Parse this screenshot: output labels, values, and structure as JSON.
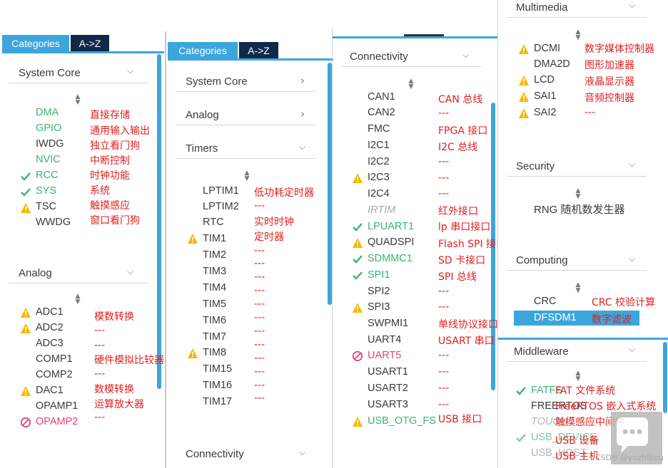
{
  "colors": {
    "accent": "#3ca6dc",
    "tab_dark": "#10284a",
    "ok": "#3cb46e",
    "warn": "#f5b800",
    "err": "#e0457b",
    "annotation": "#e02020"
  },
  "panel1": {
    "tabs": [
      "Categories",
      "A->Z"
    ],
    "sections": [
      "System Core",
      "Analog"
    ],
    "system_core": [
      {
        "name": "DMA",
        "anno": "直接存储"
      },
      {
        "name": "GPIO",
        "anno": "通用输入输出"
      },
      {
        "name": "IWDG",
        "anno": "独立看门狗"
      },
      {
        "name": "NVIC",
        "anno": "中断控制"
      },
      {
        "name": "RCC",
        "anno": "时钟功能"
      },
      {
        "name": "SYS",
        "anno": "系统"
      },
      {
        "name": "TSC",
        "anno": "触摸感应"
      },
      {
        "name": "WWDG",
        "anno": "窗口看门狗"
      }
    ],
    "analog": [
      {
        "name": "ADC1",
        "anno": "模数转换"
      },
      {
        "name": "ADC2",
        "anno": "---"
      },
      {
        "name": "ADC3",
        "anno": "---"
      },
      {
        "name": "COMP1",
        "anno": "硬件模拟比较器"
      },
      {
        "name": "COMP2",
        "anno": "---"
      },
      {
        "name": "DAC1",
        "anno": "数模转换"
      },
      {
        "name": "OPAMP1",
        "anno": "运算放大器"
      },
      {
        "name": "OPAMP2",
        "anno": "---"
      }
    ]
  },
  "panel2": {
    "tabs": [
      "Categories",
      "A->Z"
    ],
    "sections": [
      "System Core",
      "Analog",
      "Timers",
      "Connectivity"
    ],
    "timers": [
      {
        "name": "LPTIM1",
        "anno": "低功耗定时器"
      },
      {
        "name": "LPTIM2",
        "anno": "---"
      },
      {
        "name": "RTC",
        "anno": "实时时钟"
      },
      {
        "name": "TIM1",
        "anno": "定时器"
      },
      {
        "name": "TIM2",
        "anno": "---"
      },
      {
        "name": "TIM3",
        "anno": "---"
      },
      {
        "name": "TIM4",
        "anno": "---"
      },
      {
        "name": "TIM5",
        "anno": "---"
      },
      {
        "name": "TIM6",
        "anno": "---"
      },
      {
        "name": "TIM7",
        "anno": "---"
      },
      {
        "name": "TIM8",
        "anno": "---"
      },
      {
        "name": "TIM15",
        "anno": "---"
      },
      {
        "name": "TIM16",
        "anno": "---"
      },
      {
        "name": "TIM17",
        "anno": "---"
      }
    ],
    "extra_dashes": [
      "---",
      "---",
      "---",
      "---",
      "---",
      "---",
      "---",
      "---",
      "---",
      "---",
      "---",
      "---",
      "---",
      "---",
      "---"
    ]
  },
  "panel3": {
    "section": "Connectivity",
    "items": [
      {
        "name": "CAN1",
        "anno": "CAN 总线"
      },
      {
        "name": "CAN2",
        "anno": "---"
      },
      {
        "name": "FMC",
        "anno": "FPGA 接口"
      },
      {
        "name": "I2C1",
        "anno": "I2C 总线"
      },
      {
        "name": "I2C2",
        "anno": "---"
      },
      {
        "name": "I2C3",
        "anno": "---"
      },
      {
        "name": "I2C4",
        "anno": "---"
      },
      {
        "name": "IRTIM",
        "anno": "红外接口"
      },
      {
        "name": "LPUART1",
        "anno": "lp 串口接口"
      },
      {
        "name": "QUADSPI",
        "anno": "Flash SPI 接口"
      },
      {
        "name": "SDMMC1",
        "anno": "SD 卡接口"
      },
      {
        "name": "SPI1",
        "anno": "SPI 总线"
      },
      {
        "name": "SPI2",
        "anno": "---"
      },
      {
        "name": "SPI3",
        "anno": "---"
      },
      {
        "name": "SWPMI1",
        "anno": "单线协议接口"
      },
      {
        "name": "UART4",
        "anno": "USART 串口"
      },
      {
        "name": "UART5",
        "anno": "---"
      },
      {
        "name": "USART1",
        "anno": "---"
      },
      {
        "name": "USART2",
        "anno": "---"
      },
      {
        "name": "USART3",
        "anno": "---"
      },
      {
        "name": "USB_OTG_FS",
        "anno": "USB 接口"
      }
    ]
  },
  "panel4": {
    "multimedia": {
      "title": "Multimedia",
      "items": [
        {
          "name": "DCMI",
          "anno": "数字媒体控制器"
        },
        {
          "name": "DMA2D",
          "anno": "图形加速器"
        },
        {
          "name": "LCD",
          "anno": "液晶显示器"
        },
        {
          "name": "SAI1",
          "anno": "音频控制器"
        },
        {
          "name": "SAI2",
          "anno": "---"
        }
      ]
    },
    "security": {
      "title": "Security",
      "item": "RNG 随机数发生器"
    },
    "computing": {
      "title": "Computing",
      "items": [
        {
          "name": "CRC",
          "anno": "CRC 校验计算"
        },
        {
          "name": "DFSDM1",
          "anno": "数字滤波"
        }
      ]
    },
    "middleware": {
      "title": "Middleware",
      "items": [
        {
          "name": "FATFS",
          "anno": "FAT 文件系统"
        },
        {
          "name": "FREERTOS",
          "anno": "FreeRTOS 嵌入式系统"
        },
        {
          "name": "TOUCH",
          "anno": "触摸感应中间件"
        },
        {
          "name": "USB_DEVICE",
          "anno": "USB 设备"
        },
        {
          "name": "USB_HOST",
          "anno": "USB 主机"
        }
      ]
    },
    "watermark": "CSDN @yuzhibou"
  }
}
